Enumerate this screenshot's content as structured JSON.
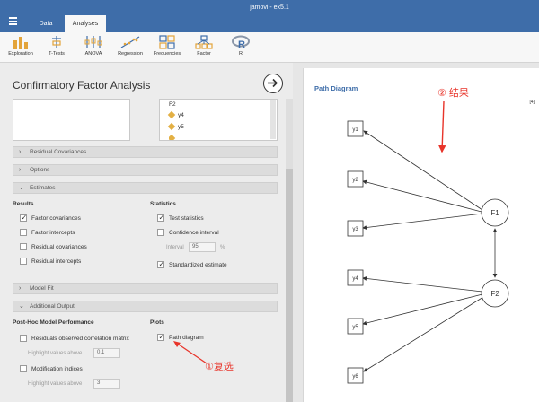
{
  "window": {
    "title": "jamovi - ex5.1"
  },
  "tabs": [
    {
      "label": "Data"
    },
    {
      "label": "Analyses"
    }
  ],
  "ribbon": [
    {
      "label": "Exploration",
      "icon": "bar-chart-icon"
    },
    {
      "label": "T-Tests",
      "icon": "t-tests-icon"
    },
    {
      "label": "ANOVA",
      "icon": "anova-icon"
    },
    {
      "label": "Regression",
      "icon": "regression-icon"
    },
    {
      "label": "Frequencies",
      "icon": "frequencies-icon"
    },
    {
      "label": "Factor",
      "icon": "factor-icon"
    },
    {
      "label": "R",
      "icon": "r-icon"
    }
  ],
  "panel": {
    "title": "Confirmatory Factor Analysis",
    "factor_box": {
      "factor": "F2",
      "items": [
        "y4",
        "y5"
      ]
    }
  },
  "sections": {
    "residual_covariances": "Residual Covariances",
    "options": "Options",
    "estimates": "Estimates",
    "model_fit": "Model Fit",
    "additional_output": "Additional Output"
  },
  "results": {
    "header": "Results",
    "factor_covariances": {
      "label": "Factor covariances",
      "checked": true
    },
    "factor_intercepts": {
      "label": "Factor intercepts",
      "checked": false
    },
    "residual_covariances": {
      "label": "Residual covariances",
      "checked": false
    },
    "residual_intercepts": {
      "label": "Residual intercepts",
      "checked": false
    }
  },
  "statistics": {
    "header": "Statistics",
    "test_statistics": {
      "label": "Test statistics",
      "checked": true
    },
    "confidence_interval": {
      "label": "Confidence interval",
      "checked": false
    },
    "interval_label": "Interval",
    "interval_value": "95",
    "interval_unit": "%",
    "standardized_estimate": {
      "label": "Standardized estimate",
      "checked": true
    }
  },
  "posthoc": {
    "header": "Post-Hoc Model Performance",
    "residuals_matrix": {
      "label": "Residuals observed correlation matrix",
      "checked": false
    },
    "highlight_label_1": "Highlight values above",
    "highlight_value_1": "0.1",
    "modification_indices": {
      "label": "Modification indices",
      "checked": false
    },
    "highlight_label_2": "Highlight values above",
    "highlight_value_2": "3"
  },
  "plots": {
    "header": "Plots",
    "path_diagram": {
      "label": "Path diagram",
      "checked": true
    }
  },
  "annotations": {
    "step1": "①复选",
    "step2": "② 结果"
  },
  "results_panel": {
    "title": "Path Diagram",
    "help_marker": "[4]",
    "observed": [
      "y1",
      "y2",
      "y3",
      "y4",
      "y5",
      "y6"
    ],
    "latent": [
      "F1",
      "F2"
    ]
  },
  "colors": {
    "titlebar": "#3e6da9",
    "accent": "#3e6da9",
    "annotation": "#e8342a"
  }
}
